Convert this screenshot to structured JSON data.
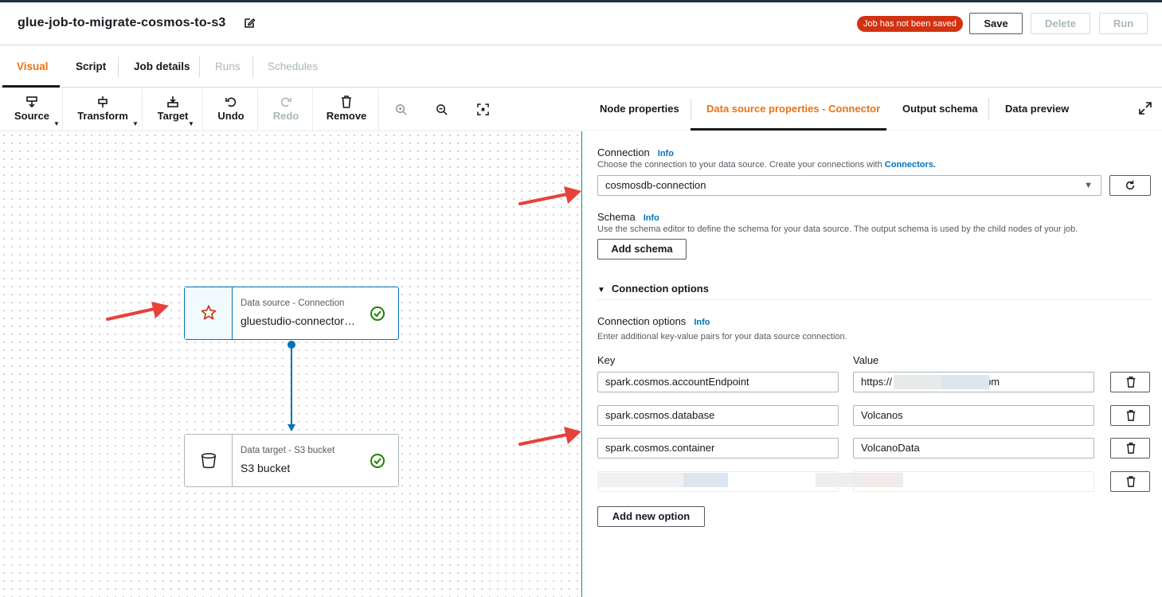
{
  "header": {
    "job_title": "glue-job-to-migrate-cosmos-to-s3",
    "status_badge": "Job has not been saved",
    "save_label": "Save",
    "delete_label": "Delete",
    "run_label": "Run"
  },
  "tabs": [
    "Visual",
    "Script",
    "Job details",
    "Runs",
    "Schedules"
  ],
  "toolbar": {
    "source": "Source",
    "transform": "Transform",
    "target": "Target",
    "undo": "Undo",
    "redo": "Redo",
    "remove": "Remove"
  },
  "nodes": [
    {
      "type": "Data source - Connection",
      "name": "gluestudio-connector…",
      "icon": "connector-icon"
    },
    {
      "type": "Data target - S3 bucket",
      "name": "S3 bucket",
      "icon": "bucket-icon"
    }
  ],
  "panel": {
    "tabs": [
      "Node properties",
      "Data source properties - Connector",
      "Output schema",
      "Data preview"
    ],
    "connection": {
      "label": "Connection",
      "info": "Info",
      "desc": "Choose the connection to your data source. Create your connections with",
      "desc_link": "Connectors.",
      "value": "cosmosdb-connection"
    },
    "schema": {
      "label": "Schema",
      "info": "Info",
      "desc": "Use the schema editor to define the schema for your data source. The output schema is used by the child nodes of your job.",
      "button": "Add schema"
    },
    "section_title": "Connection options",
    "options": {
      "label": "Connection options",
      "info": "Info",
      "desc": "Enter additional key-value pairs for your data source connection.",
      "key_header": "Key",
      "value_header": "Value",
      "rows": [
        {
          "key": "spark.cosmos.accountEndpoint",
          "value": "https://                         .documents.azure.com"
        },
        {
          "key": "spark.cosmos.database",
          "value": "Volcanos"
        },
        {
          "key": "spark.cosmos.container",
          "value": "VolcanoData"
        },
        {
          "key": "",
          "value": ""
        }
      ],
      "add_button": "Add new option"
    }
  },
  "colors": {
    "accent": "#ec7211",
    "link": "#0073bb",
    "badge": "#d13212",
    "arrow": "#e8413a",
    "ok": "#1d8102"
  }
}
